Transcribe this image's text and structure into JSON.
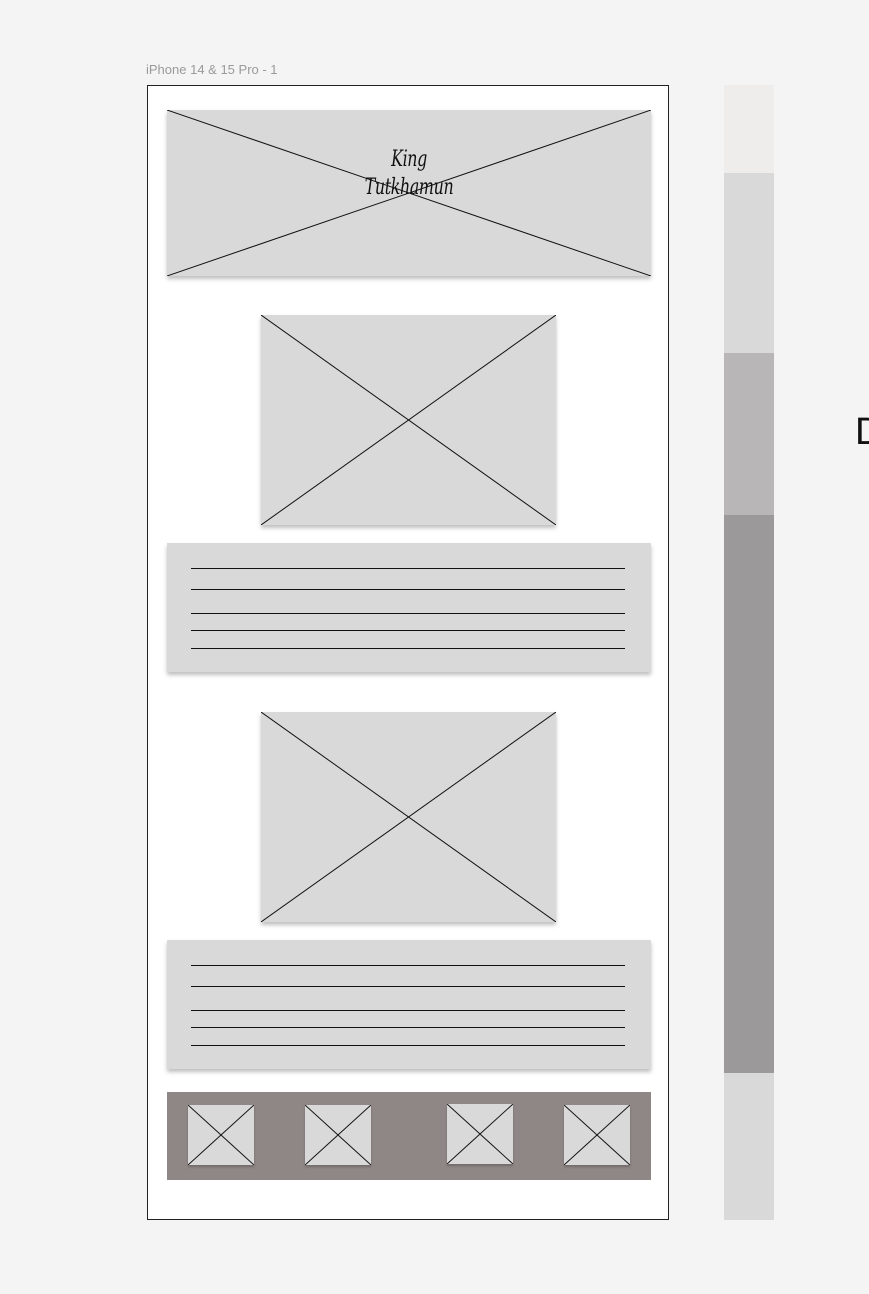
{
  "canvas": {
    "frame_label": "iPhone 14 & 15 Pro - 1",
    "edge_text": "D"
  },
  "hero": {
    "title_line1": "King",
    "title_line2": "Tutkhamun"
  },
  "thumbnails": {
    "count": 4
  },
  "palette": {
    "background": "#f4f4f4",
    "frame_fill": "#ffffff",
    "placeholder_fill": "#d9d9d9",
    "thumb_bar_fill": "#8f8785",
    "swatches": [
      "#efecec",
      "#d9d9d9",
      "#b8b6b6",
      "#9b9999",
      "#d9d9d9"
    ]
  }
}
